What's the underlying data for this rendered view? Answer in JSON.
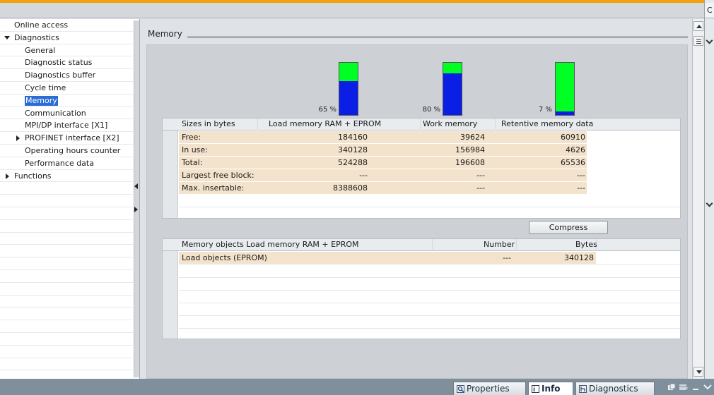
{
  "nav": {
    "items": [
      {
        "label": "Online access",
        "indent": 0,
        "arrow": ""
      },
      {
        "label": "Diagnostics",
        "indent": 0,
        "arrow": "down"
      },
      {
        "label": "General",
        "indent": 1,
        "arrow": ""
      },
      {
        "label": "Diagnostic status",
        "indent": 1,
        "arrow": ""
      },
      {
        "label": "Diagnostics buffer",
        "indent": 1,
        "arrow": ""
      },
      {
        "label": "Cycle time",
        "indent": 1,
        "arrow": ""
      },
      {
        "label": "Memory",
        "indent": 1,
        "arrow": "",
        "selected": true
      },
      {
        "label": "Communication",
        "indent": 1,
        "arrow": ""
      },
      {
        "label": "MPI/DP interface [X1]",
        "indent": 1,
        "arrow": ""
      },
      {
        "label": "PROFINET interface [X2]",
        "indent": 1,
        "arrow": "right"
      },
      {
        "label": "Operating hours counter",
        "indent": 1,
        "arrow": ""
      },
      {
        "label": "Performance data",
        "indent": 1,
        "arrow": ""
      },
      {
        "label": "Functions",
        "indent": 0,
        "arrow": "right"
      }
    ]
  },
  "section": {
    "title": "Memory"
  },
  "bars": [
    {
      "percent_label": "65 %",
      "used_fraction": 0.65
    },
    {
      "percent_label": "80 %",
      "used_fraction": 0.8
    },
    {
      "percent_label": "7 %",
      "used_fraction": 0.07
    }
  ],
  "sizes_table": {
    "headers": [
      "Sizes in bytes",
      "Load memory RAM + EPROM",
      "Work memory",
      "Retentive memory data"
    ],
    "rows": [
      [
        "Free:",
        "184160",
        "39624",
        "60910"
      ],
      [
        "In use:",
        "340128",
        "156984",
        "4626"
      ],
      [
        "Total:",
        "524288",
        "196608",
        "65536"
      ],
      [
        "Largest free block:",
        "---",
        "---",
        "---"
      ],
      [
        "Max. insertable:",
        "8388608",
        "---",
        "---"
      ]
    ]
  },
  "compress_label": "Compress",
  "objects_table": {
    "headers": [
      "Memory objects Load memory RAM + EPROM",
      "Number",
      "Bytes"
    ],
    "rows": [
      [
        "Load objects (EPROM)",
        "---",
        "340128"
      ]
    ]
  },
  "right_strip": {
    "top_letter": "C"
  },
  "bottom_tabs": [
    {
      "label": "Properties",
      "icon": "properties-icon",
      "active": false
    },
    {
      "label": "Info",
      "icon": "info-icon",
      "active": true
    },
    {
      "label": "Diagnostics",
      "icon": "diagnostics-icon",
      "active": false
    }
  ],
  "colors": {
    "accent": "#f0a30a",
    "bar_free": "#00ff22",
    "bar_used": "#0a1ee6",
    "row_bg": "#f3e3cc",
    "selection": "#2b6cd4"
  }
}
